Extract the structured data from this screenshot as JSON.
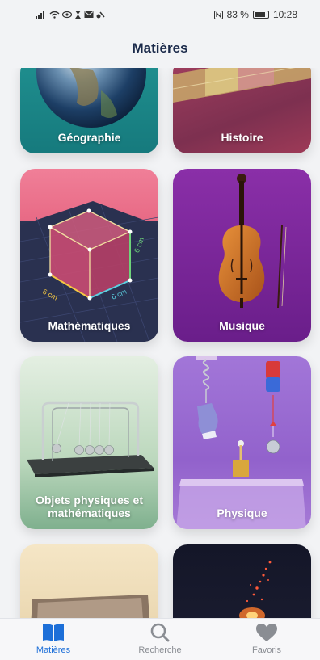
{
  "status_bar": {
    "battery": "83 %",
    "time": "10:28"
  },
  "header": {
    "title": "Matières"
  },
  "subjects": [
    {
      "label": "Géographie"
    },
    {
      "label": "Histoire"
    },
    {
      "label": "Mathématiques"
    },
    {
      "label": "Musique"
    },
    {
      "label": "Objets physiques et mathématiques"
    },
    {
      "label": "Physique"
    }
  ],
  "math_card": {
    "cube_dimension": "6 cm"
  },
  "tabs": [
    {
      "label": "Matières",
      "icon": "book-icon",
      "active": true
    },
    {
      "label": "Recherche",
      "icon": "search-icon",
      "active": false
    },
    {
      "label": "Favoris",
      "icon": "heart-icon",
      "active": false
    }
  ],
  "colors": {
    "accent": "#1d6fd8",
    "title": "#1b2a4a",
    "inactive_tab": "#8a8d93"
  }
}
